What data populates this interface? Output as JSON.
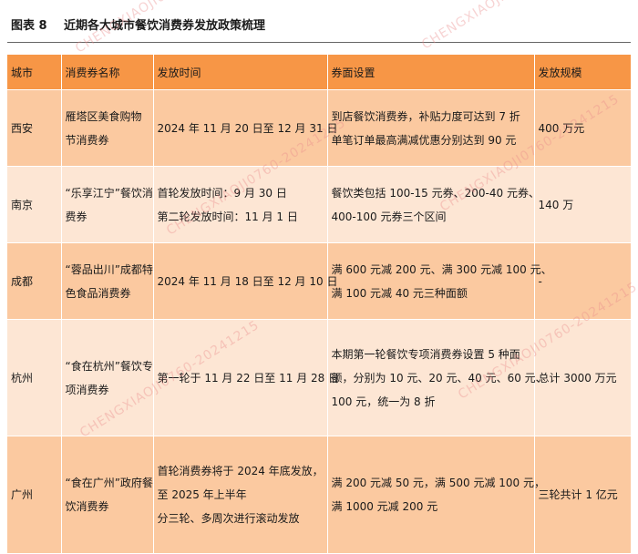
{
  "figure": {
    "label": "图表 8",
    "title": "近期各大城市餐饮消费券发放政策梳理"
  },
  "table": {
    "headers": [
      "城市",
      "消费券名称",
      "发放时间",
      "券面设置",
      "发放规模"
    ],
    "rows": [
      {
        "city": "西安",
        "name": [
          "雁塔区美食购物",
          "节消费券"
        ],
        "time": [
          "2024 年 11 月 20 日至 12 月 31 日"
        ],
        "setting": [
          "到店餐饮消费券，补贴力度可达到 7 折",
          "单笔订单最高满减优惠分别达到 90 元"
        ],
        "scale": "400 万元"
      },
      {
        "city": "南京",
        "name": [
          "“乐享江宁”餐饮消",
          "费券"
        ],
        "time": [
          "首轮发放时间：9 月 30 日",
          "第二轮发放时间：11 月 1 日"
        ],
        "setting": [
          "餐饮类包括 100-15 元券、200-40 元券、",
          "400-100 元券三个区间"
        ],
        "scale": "140 万"
      },
      {
        "city": "成都",
        "name": [
          "“蓉品出川”成都特",
          "色食品消费券"
        ],
        "time": [
          "2024 年 11 月 18 日至 12 月 10 日"
        ],
        "setting": [
          "满 600 元减 200 元、满 300 元减 100 元、",
          "满 100 元减 40 元三种面额"
        ],
        "scale": "-"
      },
      {
        "city": "杭州",
        "name": [
          "“食在杭州”餐饮专",
          "项消费券"
        ],
        "time": [
          "第一轮于 11 月 22 日至 11 月 28 日"
        ],
        "setting": [
          "本期第一轮餐饮专项消费券设置 5 种面",
          "额，分别为 10 元、20 元、40 元、60 元、",
          "100 元，统一为 8 折"
        ],
        "scale": "总计 3000 万元"
      },
      {
        "city": "广州",
        "name": [
          "“食在广州”政府餐",
          "饮消费券"
        ],
        "time": [
          "首轮消费券将于 2024 年底发放，",
          "至 2025 年上半年",
          "分三轮、多周次进行滚动发放"
        ],
        "setting": [
          "满 200 元减 50 元，满 500 元减 100 元，",
          "满 1000 元减 200 元"
        ],
        "scale": "三轮共计 1 亿元"
      }
    ]
  },
  "watermark": "CHENGXIAOJI0760-20241215"
}
